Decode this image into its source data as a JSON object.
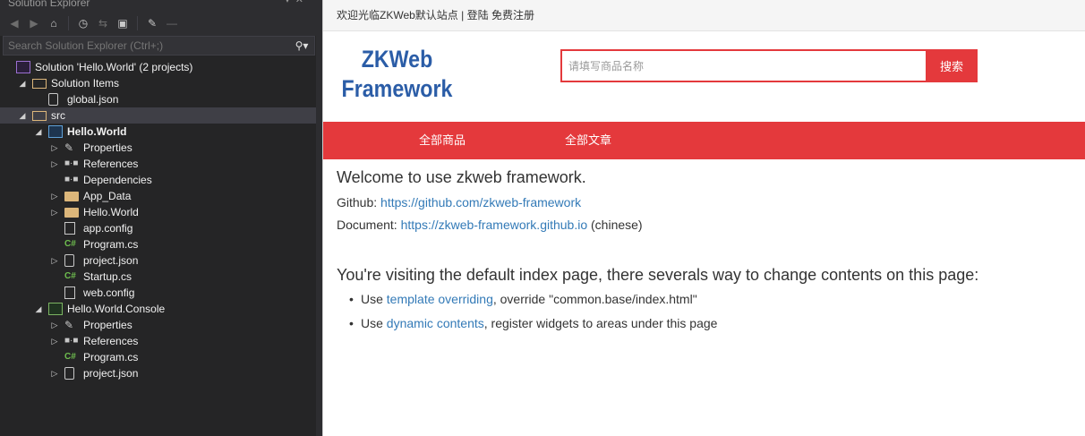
{
  "solution_explorer": {
    "title": "Solution Explorer",
    "search_placeholder": "Search Solution Explorer (Ctrl+;)",
    "tree": [
      {
        "label": "Solution 'Hello.World' (2 projects)",
        "icon": "solution-icon",
        "expander": "",
        "bold": false
      },
      {
        "label": "Solution Items",
        "icon": "folder-open-icon",
        "expander": "collapse",
        "bold": false
      },
      {
        "label": "global.json",
        "icon": "json-file-icon",
        "expander": "",
        "bold": false
      },
      {
        "label": "src",
        "icon": "folder-open-icon",
        "expander": "collapse",
        "bold": false
      },
      {
        "label": "Hello.World",
        "icon": "web-project-icon",
        "expander": "collapse",
        "bold": true
      },
      {
        "label": "Properties",
        "icon": "wrench-icon",
        "expander": "expand",
        "bold": false
      },
      {
        "label": "References",
        "icon": "references-icon",
        "expander": "expand",
        "bold": false
      },
      {
        "label": "Dependencies",
        "icon": "references-icon",
        "expander": "",
        "bold": false
      },
      {
        "label": "App_Data",
        "icon": "folder-icon",
        "expander": "expand",
        "bold": false
      },
      {
        "label": "Hello.World",
        "icon": "folder-icon",
        "expander": "expand",
        "bold": false
      },
      {
        "label": "app.config",
        "icon": "config-file-icon",
        "expander": "",
        "bold": false
      },
      {
        "label": "Program.cs",
        "icon": "csharp-file-icon",
        "expander": "",
        "bold": false
      },
      {
        "label": "project.json",
        "icon": "json-file-icon",
        "expander": "expand",
        "bold": false
      },
      {
        "label": "Startup.cs",
        "icon": "csharp-file-icon",
        "expander": "",
        "bold": false
      },
      {
        "label": "web.config",
        "icon": "config-file-icon",
        "expander": "",
        "bold": false
      },
      {
        "label": "Hello.World.Console",
        "icon": "console-project-icon",
        "expander": "collapse",
        "bold": false
      },
      {
        "label": "Properties",
        "icon": "wrench-icon",
        "expander": "expand",
        "bold": false
      },
      {
        "label": "References",
        "icon": "references-icon",
        "expander": "expand",
        "bold": false
      },
      {
        "label": "Program.cs",
        "icon": "csharp-file-icon",
        "expander": "",
        "bold": false
      },
      {
        "label": "project.json",
        "icon": "json-file-icon",
        "expander": "expand",
        "bold": false
      }
    ]
  },
  "web": {
    "topbar": {
      "welcome": "欢迎光临ZKWeb默认站点",
      "separator": " | ",
      "login": "登陆",
      "register": "免费注册"
    },
    "logo_line1": "ZKWeb",
    "logo_line2": "Framework",
    "search": {
      "placeholder": "请填写商品名称",
      "button": "搜索"
    },
    "nav": [
      "全部商品",
      "全部文章"
    ],
    "content": {
      "heading": "Welcome to use zkweb framework.",
      "github_label": "Github: ",
      "github_link": "https://github.com/zkweb-framework",
      "document_label": "Document: ",
      "document_link": "https://zkweb-framework.github.io",
      "document_note": " (chinese)",
      "subheading": "You're visiting the default index page, there severals way to change contents on this page:",
      "bullets": [
        {
          "prefix": "Use ",
          "link": "template overriding",
          "suffix": ", override \"common.base/index.html\""
        },
        {
          "prefix": "Use ",
          "link": "dynamic contents",
          "suffix": ", register widgets to areas under this page"
        }
      ]
    },
    "colors": {
      "accent": "#e4393c",
      "logo": "#2b5da7",
      "link": "#337ab7"
    }
  }
}
